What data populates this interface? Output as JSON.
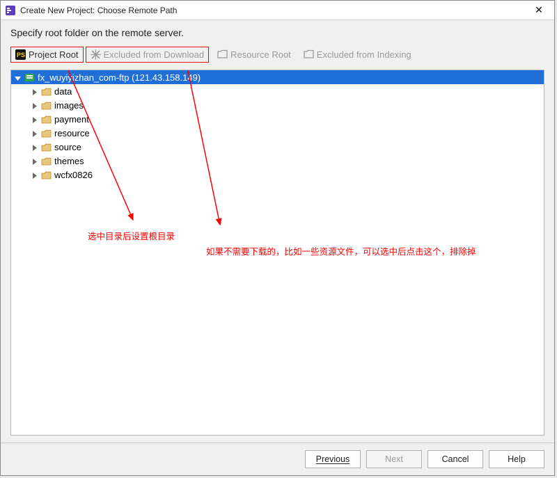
{
  "window": {
    "title": "Create New Project: Choose Remote Path",
    "close_glyph": "✕"
  },
  "instruction": "Specify root folder on the remote server.",
  "toolbar": {
    "project_root": "Project Root",
    "excluded_from_download": "Excluded from Download",
    "resource_root": "Resource Root",
    "excluded_from_indexing": "Excluded from Indexing"
  },
  "tree": {
    "root_label": "fx_wuyiyizhan_com-ftp (121.43.158.149)",
    "children": [
      {
        "label": "data"
      },
      {
        "label": "images"
      },
      {
        "label": "payment"
      },
      {
        "label": "resource"
      },
      {
        "label": "source"
      },
      {
        "label": "themes"
      },
      {
        "label": "wcfx0826"
      }
    ]
  },
  "annotations": {
    "note1": "选中目录后设置根目录",
    "note2": "如果不需要下载的，比如一些资源文件，可以选中后点击这个，排除掉"
  },
  "buttons": {
    "previous": "Previous",
    "next": "Next",
    "cancel": "Cancel",
    "help": "Help"
  },
  "colors": {
    "accent_red": "#ff0000",
    "selection_blue": "#1f6fd6",
    "grey_text": "#9a9a9a"
  }
}
